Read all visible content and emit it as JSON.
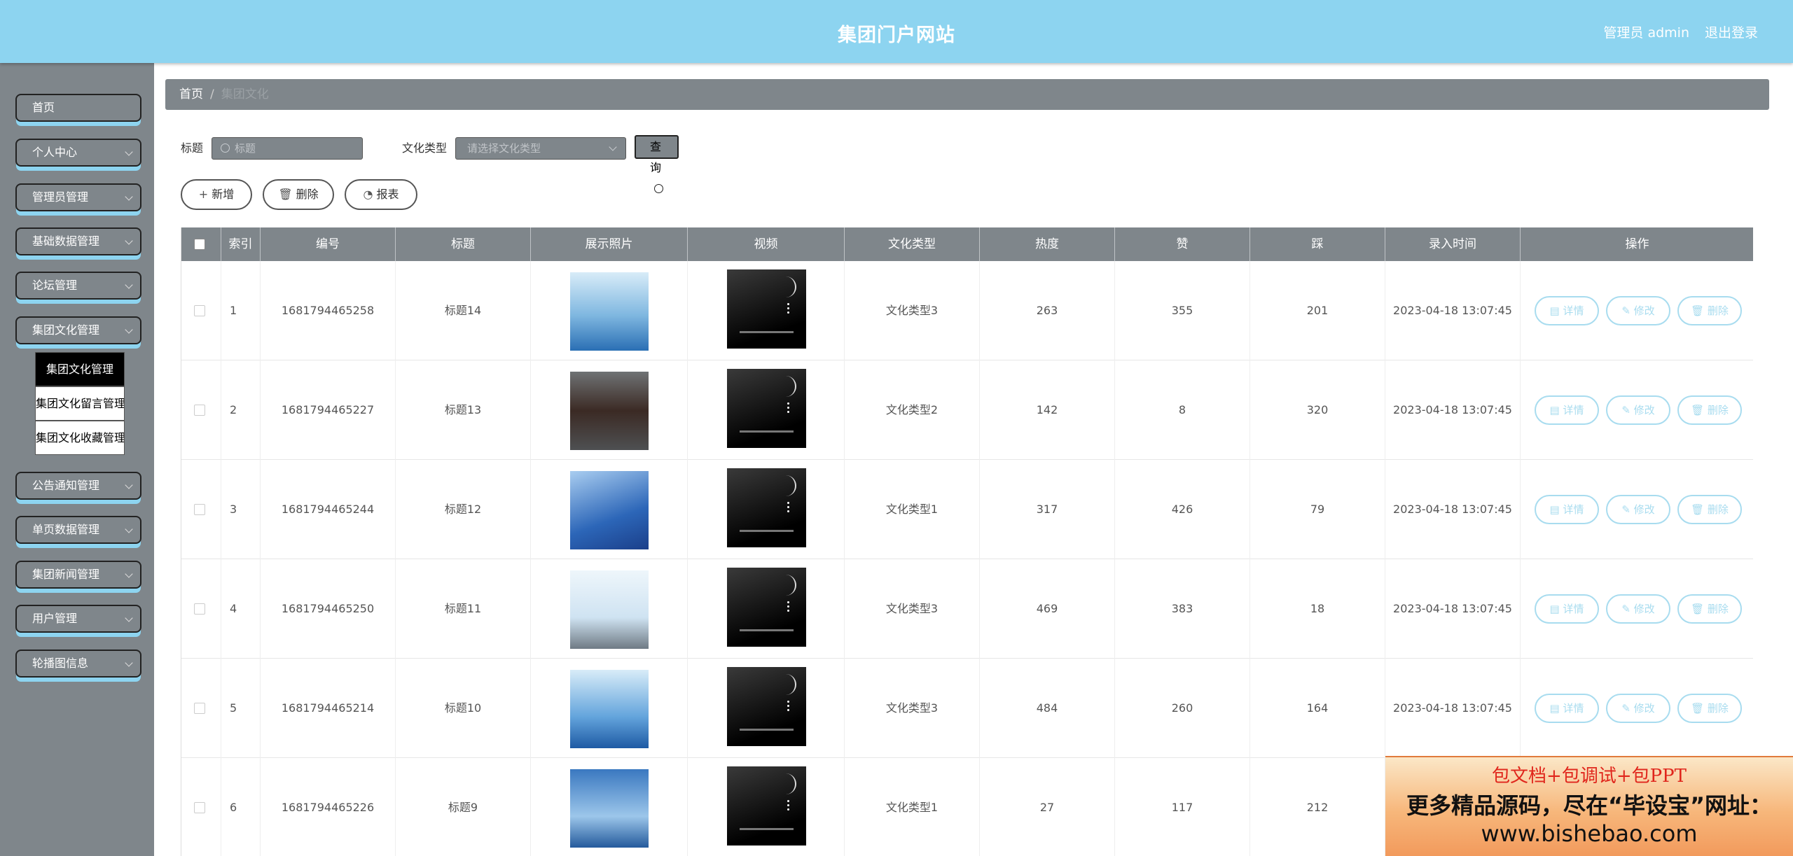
{
  "header": {
    "title": "集团门户网站",
    "admin": "管理员 admin",
    "logout": "退出登录"
  },
  "sidebar": {
    "items": [
      {
        "label": "首页",
        "expandable": false
      },
      {
        "label": "个人中心",
        "expandable": true
      },
      {
        "label": "管理员管理",
        "expandable": true
      },
      {
        "label": "基础数据管理",
        "expandable": true
      },
      {
        "label": "论坛管理",
        "expandable": true
      },
      {
        "label": "集团文化管理",
        "expandable": true
      },
      {
        "label": "公告通知管理",
        "expandable": true
      },
      {
        "label": "单页数据管理",
        "expandable": true
      },
      {
        "label": "集团新闻管理",
        "expandable": true
      },
      {
        "label": "用户管理",
        "expandable": true
      },
      {
        "label": "轮播图信息",
        "expandable": true
      }
    ],
    "submenu": [
      {
        "label": "集团文化管理",
        "active": true
      },
      {
        "label": "集团文化留言管理",
        "active": false
      },
      {
        "label": "集团文化收藏管理",
        "active": false
      }
    ]
  },
  "breadcrumb": {
    "home": "首页",
    "separator": "/",
    "current": "集团文化"
  },
  "search": {
    "title_label": "标题",
    "title_placeholder": "标题",
    "type_label": "文化类型",
    "type_placeholder": "请选择文化类型",
    "query_label": "查询"
  },
  "actions": {
    "add": "新增",
    "delete": "删除",
    "report": "报表"
  },
  "table": {
    "headers": [
      "索引",
      "编号",
      "标题",
      "展示照片",
      "视频",
      "文化类型",
      "热度",
      "赞",
      "踩",
      "录入时间",
      "操作"
    ],
    "rows": [
      {
        "index": "1",
        "code": "1681794465258",
        "title": "标题14",
        "type": "文化类型3",
        "heat": "263",
        "likes": "355",
        "dislikes": "201",
        "time": "2023-04-18 13:07:45"
      },
      {
        "index": "2",
        "code": "1681794465227",
        "title": "标题13",
        "type": "文化类型2",
        "heat": "142",
        "likes": "8",
        "dislikes": "320",
        "time": "2023-04-18 13:07:45"
      },
      {
        "index": "3",
        "code": "1681794465244",
        "title": "标题12",
        "type": "文化类型1",
        "heat": "317",
        "likes": "426",
        "dislikes": "79",
        "time": "2023-04-18 13:07:45"
      },
      {
        "index": "4",
        "code": "1681794465250",
        "title": "标题11",
        "type": "文化类型3",
        "heat": "469",
        "likes": "383",
        "dislikes": "18",
        "time": "2023-04-18 13:07:45"
      },
      {
        "index": "5",
        "code": "1681794465214",
        "title": "标题10",
        "type": "文化类型3",
        "heat": "484",
        "likes": "260",
        "dislikes": "164",
        "time": "2023-04-18 13:07:45"
      },
      {
        "index": "6",
        "code": "1681794465226",
        "title": "标题9",
        "type": "文化类型1",
        "heat": "27",
        "likes": "117",
        "dislikes": "212",
        "time": ""
      }
    ],
    "row_actions": {
      "detail": "详情",
      "edit": "修改",
      "delete": "删除"
    }
  },
  "watermark": {
    "line1": "包文档+包调试+包PPT",
    "line2": "更多精品源码，尽在“毕设宝”网址：",
    "line3": "www.bishebao.com"
  },
  "colors": {
    "header": "#8dd4f0",
    "sidebar": "#7f868b",
    "accent": "#a8dcef"
  }
}
